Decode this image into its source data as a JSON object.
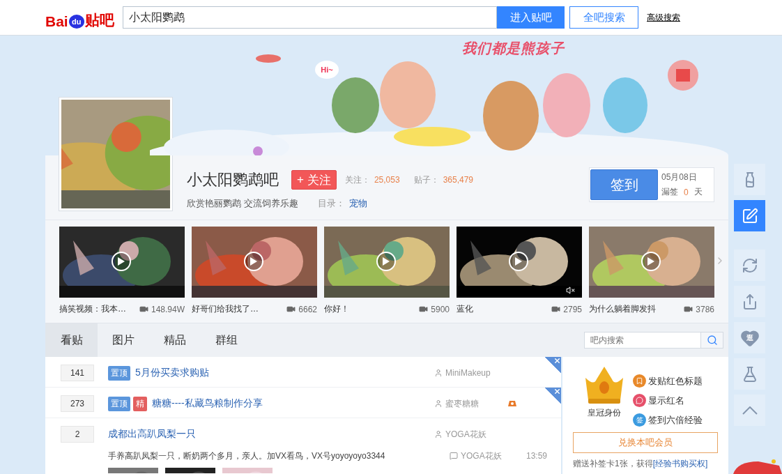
{
  "header": {
    "logo": {
      "part_1": "Bai",
      "part_2": "du",
      "part_3": "贴吧"
    },
    "search": {
      "value": "小太阳鹦鹉"
    },
    "enter_button": "进入贴吧",
    "search_all_button": "全吧搜索",
    "advanced_link": "高级搜索"
  },
  "banner": {
    "slogan": "我们都是熊孩子",
    "bubble": "Hi~"
  },
  "forum": {
    "name": "小太阳鹦鹉吧",
    "follow_button": {
      "icon": "+",
      "label": "关注"
    },
    "followers_label": "关注：",
    "followers": "25,053",
    "posts_label": "贴子：",
    "posts": "365,479",
    "motto": "欣赏艳丽鹦鹉 交流饲养乐趣",
    "category_label": "目录：",
    "category": "宠物",
    "sign_in": {
      "button": "签到",
      "date": "05月08日",
      "missed_label": "漏签",
      "missed": "0",
      "missed_unit": "天"
    }
  },
  "videos": [
    {
      "title": "搞笑视频：我本…",
      "views": "148.94W",
      "muted": false
    },
    {
      "title": "好哥们给我找了…",
      "views": "6662",
      "muted": false
    },
    {
      "title": "你好！",
      "views": "5900",
      "muted": false
    },
    {
      "title": "蓝化",
      "views": "2795",
      "muted": true
    },
    {
      "title": "为什么躺着脚发抖",
      "views": "3786",
      "muted": false
    }
  ],
  "tabs": [
    {
      "label": "看贴",
      "selected": true
    },
    {
      "label": "图片",
      "selected": false
    },
    {
      "label": "精品",
      "selected": false
    },
    {
      "label": "群组",
      "selected": false
    }
  ],
  "forum_search": {
    "placeholder": "吧内搜索"
  },
  "threads": [
    {
      "replies": "141",
      "tags": [
        {
          "kind": "top",
          "label": "置顶"
        }
      ],
      "title": "5月份买卖求购贴",
      "author": "MiniMakeup",
      "badge": false,
      "pinned_close": true
    },
    {
      "replies": "273",
      "tags": [
        {
          "kind": "top",
          "label": "置顶"
        },
        {
          "kind": "good",
          "label": "精"
        }
      ],
      "title": "糖糖----私藏鸟粮制作分享",
      "author": "蜜枣糖糖",
      "badge": true,
      "pinned_close": true
    },
    {
      "replies": "2",
      "title": "成都出高趴凤梨一只",
      "author": "YOGA花妖",
      "badge": false,
      "pinned_close": false,
      "abstract": "手养高趴凤梨一只，断奶两个多月，亲人。加VX看鸟，VX号yoyoyoyo3344",
      "last_replier": "YOGA花妖",
      "time": "13:59"
    }
  ],
  "member_panel": {
    "crown_label": "皇冠身份",
    "perks": [
      {
        "kind": "bookmark",
        "text": "发贴红色标题",
        "color": "#e8892a"
      },
      {
        "kind": "chat",
        "text": "显示红名",
        "color": "#e6506a"
      },
      {
        "kind": "sign",
        "icon_text": "签",
        "text": "签到六倍经验",
        "color": "#3b9be0"
      }
    ],
    "button": "兑换本吧会员",
    "note": "赠送补签卡1张，获得",
    "note_link": "[经验书购买权]"
  },
  "tools": [
    {
      "kind": "bottle",
      "selected": false
    },
    {
      "kind": "edit",
      "selected": true
    },
    {
      "kind": "refresh",
      "selected": false
    },
    {
      "kind": "share",
      "selected": false
    },
    {
      "kind": "heart",
      "label": "逛",
      "selected": false
    },
    {
      "kind": "flask",
      "selected": false
    },
    {
      "kind": "top",
      "selected": false
    }
  ]
}
